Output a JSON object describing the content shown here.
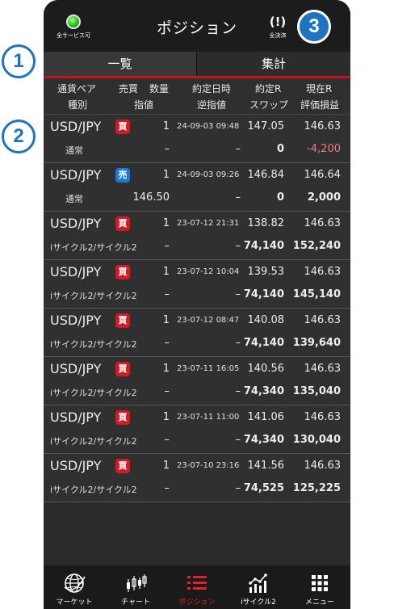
{
  "header": {
    "status_label": "全サービス可",
    "title": "ポジション",
    "settle_all_label": "全決済",
    "settle_all_icon": "(!)"
  },
  "tabs": [
    {
      "label": "一覧",
      "active": true
    },
    {
      "label": "集計",
      "active": false
    }
  ],
  "columns": {
    "row1": [
      "通貨ペア",
      "売買",
      "数量",
      "約定日時",
      "約定R",
      "現在R"
    ],
    "row2": [
      "種別",
      "指値",
      "逆指値",
      "スワップ",
      "評価損益"
    ]
  },
  "positions": [
    {
      "pair": "USD/JPY",
      "side": "買",
      "side_type": "buy",
      "qty": "1",
      "date": "24-09-03 09:48",
      "rate": "147.05",
      "current": "146.63",
      "type": "通常",
      "limit": "–",
      "stop": "–",
      "swap": "0",
      "pl": "-4,200"
    },
    {
      "pair": "USD/JPY",
      "side": "売",
      "side_type": "sell",
      "qty": "1",
      "date": "24-09-03 09:26",
      "rate": "146.84",
      "current": "146.64",
      "type": "通常",
      "limit": "146.50",
      "stop": "–",
      "swap": "0",
      "pl": "2,000"
    },
    {
      "pair": "USD/JPY",
      "side": "買",
      "side_type": "buy",
      "qty": "1",
      "date": "23-07-12 21:31",
      "rate": "138.82",
      "current": "146.63",
      "type": "iサイクル2/サイクル2",
      "limit": "–",
      "stop": "–",
      "swap": "74,140",
      "pl": "152,240"
    },
    {
      "pair": "USD/JPY",
      "side": "買",
      "side_type": "buy",
      "qty": "1",
      "date": "23-07-12 10:04",
      "rate": "139.53",
      "current": "146.63",
      "type": "iサイクル2/サイクル2",
      "limit": "–",
      "stop": "–",
      "swap": "74,140",
      "pl": "145,140"
    },
    {
      "pair": "USD/JPY",
      "side": "買",
      "side_type": "buy",
      "qty": "1",
      "date": "23-07-12 08:47",
      "rate": "140.08",
      "current": "146.63",
      "type": "iサイクル2/サイクル2",
      "limit": "–",
      "stop": "–",
      "swap": "74,140",
      "pl": "139,640"
    },
    {
      "pair": "USD/JPY",
      "side": "買",
      "side_type": "buy",
      "qty": "1",
      "date": "23-07-11 16:05",
      "rate": "140.56",
      "current": "146.63",
      "type": "iサイクル2/サイクル2",
      "limit": "–",
      "stop": "–",
      "swap": "74,340",
      "pl": "135,040"
    },
    {
      "pair": "USD/JPY",
      "side": "買",
      "side_type": "buy",
      "qty": "1",
      "date": "23-07-11 11:00",
      "rate": "141.06",
      "current": "146.63",
      "type": "iサイクル2/サイクル2",
      "limit": "–",
      "stop": "–",
      "swap": "74,340",
      "pl": "130,040"
    },
    {
      "pair": "USD/JPY",
      "side": "買",
      "side_type": "buy",
      "qty": "1",
      "date": "23-07-10 23:16",
      "rate": "141.56",
      "current": "146.63",
      "type": "iサイクル2/サイクル2",
      "limit": "–",
      "stop": "–",
      "swap": "74,525",
      "pl": "125,225"
    }
  ],
  "bottom_nav": [
    {
      "label": "マーケット",
      "icon": "globe-icon"
    },
    {
      "label": "チャート",
      "icon": "candlestick-icon"
    },
    {
      "label": "ポジション",
      "icon": "list-icon",
      "active": true
    },
    {
      "label": "iサイクル2",
      "icon": "growth-chart-icon"
    },
    {
      "label": "メニュー",
      "icon": "grid-icon"
    }
  ],
  "callouts": [
    "1",
    "2",
    "3"
  ],
  "colors": {
    "accent": "#c8101f",
    "buy": "#d51a23",
    "sell": "#1b7ad9",
    "callout": "#1e74bf",
    "negative": "#f07a7a"
  }
}
